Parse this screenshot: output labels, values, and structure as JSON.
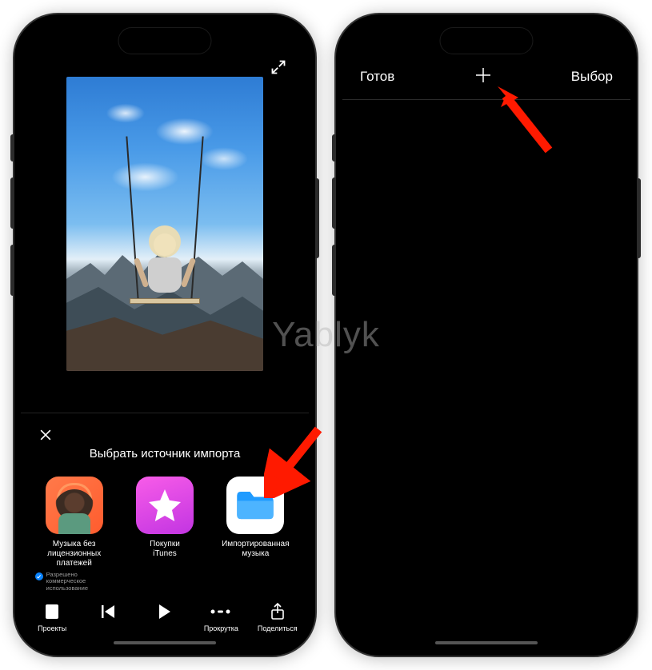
{
  "watermark": "Yablyk",
  "left": {
    "sheet_title": "Выбрать источник импорта",
    "sources": {
      "royalty": {
        "label": "Музыка без\nлицензионных\nплатежей",
        "permit": "Разрешено\nкоммерческое\nиспользование"
      },
      "itunes": {
        "label": "Покупки\niTunes"
      },
      "files": {
        "label": "Импортированная\nмузыка"
      }
    },
    "bottombar": {
      "projects": "Проекты",
      "scroll": "Прокрутка",
      "share": "Поделиться"
    }
  },
  "right": {
    "nav": {
      "done": "Готов",
      "select": "Выбор"
    }
  },
  "colors": {
    "arrow": "#ff1a00"
  }
}
